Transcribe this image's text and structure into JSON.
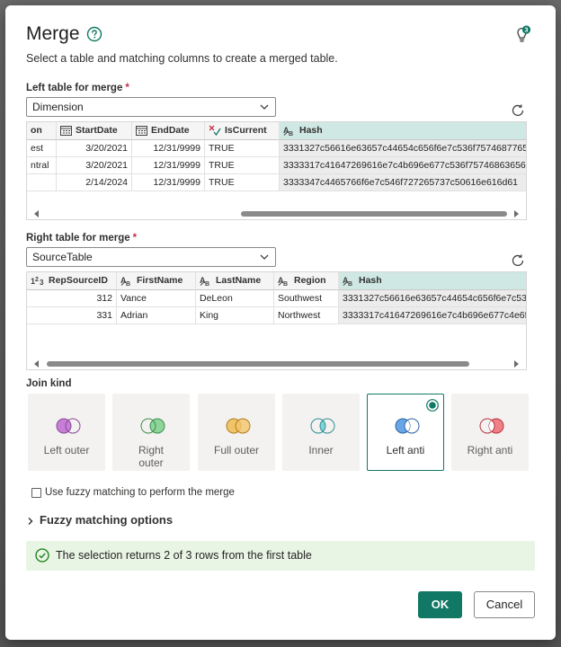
{
  "dialog": {
    "title": "Merge",
    "subtitle": "Select a table and matching columns to create a merged table.",
    "notification_count": "3"
  },
  "left_table": {
    "label": "Left table for merge",
    "required_mark": "*",
    "selected": "Dimension",
    "columns": [
      "on",
      "StartDate",
      "EndDate",
      "IsCurrent",
      "Hash"
    ],
    "rows": [
      [
        "est",
        "3/20/2021",
        "12/31/9999",
        "TRUE",
        "3331327c56616e63657c44654c656f6e7c536f75746877657..."
      ],
      [
        "ntral",
        "3/20/2021",
        "12/31/9999",
        "TRUE",
        "3333317c41647269616e7c4b696e677c536f75746863656e..."
      ],
      [
        "",
        "2/14/2024",
        "12/31/9999",
        "TRUE",
        "3333347c4465766f6e7c546f727265737c50616e616d61"
      ]
    ]
  },
  "right_table": {
    "label": "Right table for merge",
    "required_mark": "*",
    "selected": "SourceTable",
    "columns": [
      "RepSourceID",
      "FirstName",
      "LastName",
      "Region",
      "Hash"
    ],
    "rows": [
      [
        "312",
        "Vance",
        "DeLeon",
        "Southwest",
        "3331327c56616e63657c44654c656f6e7c536f7"
      ],
      [
        "331",
        "Adrian",
        "King",
        "Northwest",
        "3333317c41647269616e7c4b696e677c4e6f72"
      ]
    ]
  },
  "join_kind": {
    "label": "Join kind",
    "options": [
      "Left outer",
      "Right outer",
      "Full outer",
      "Inner",
      "Left anti",
      "Right anti"
    ],
    "selected": "Left anti"
  },
  "fuzzy": {
    "checkbox_label": "Use fuzzy matching to perform the merge",
    "checked": false,
    "options_label": "Fuzzy matching options"
  },
  "banner": {
    "text": "The selection returns 2 of 3 rows from the first table"
  },
  "buttons": {
    "ok": "OK",
    "cancel": "Cancel"
  },
  "colors": {
    "accent": "#117865",
    "selected_column": "#cfe8e3",
    "success_banner": "#e9f5e4",
    "required": "#c4314b"
  },
  "icons": {
    "help": "help-circle-icon",
    "notifications": "lightbulb-icon",
    "refresh": "refresh-icon",
    "dropdown": "chevron-down-icon",
    "success": "checkmark-circle-icon"
  }
}
